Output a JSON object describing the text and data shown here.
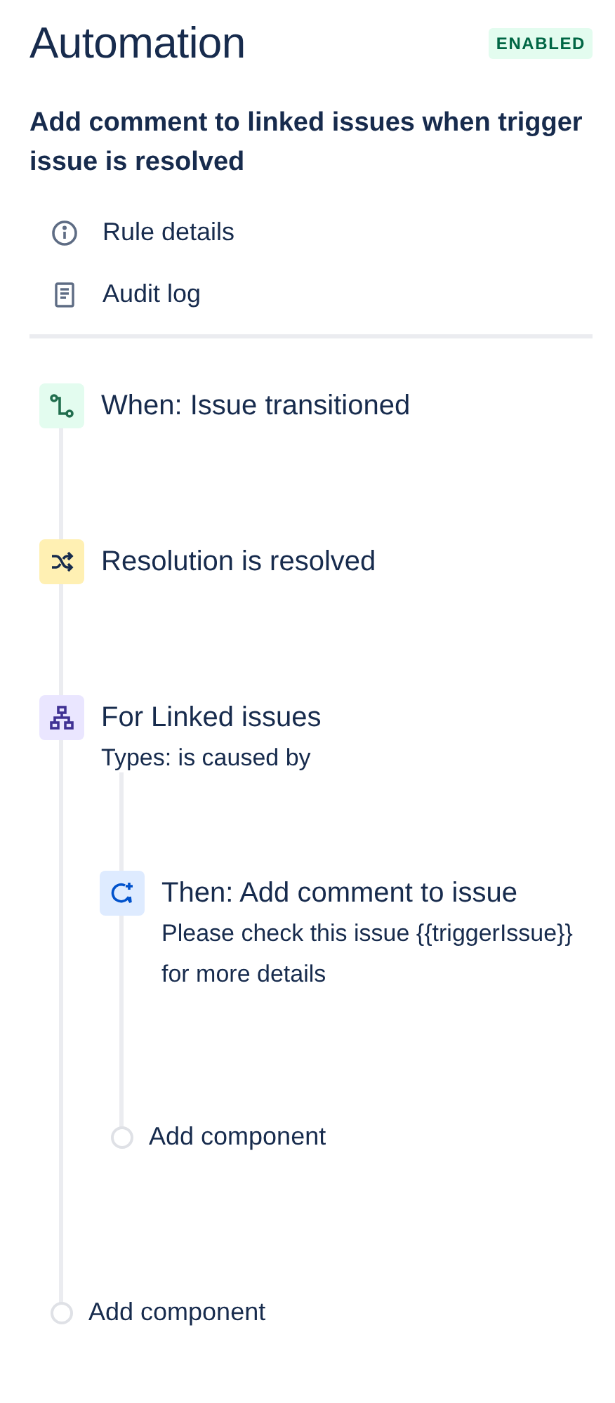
{
  "header": {
    "title": "Automation",
    "status": "ENABLED",
    "enabled": true
  },
  "rule_name": "Add comment to linked issues when trigger issue is resolved",
  "menu": [
    {
      "kind": "info",
      "label": "Rule details"
    },
    {
      "kind": "log",
      "label": "Audit log"
    }
  ],
  "steps": [
    {
      "kind": "trigger",
      "title": "When: Issue transitioned"
    },
    {
      "kind": "condition",
      "title": "Resolution is resolved"
    },
    {
      "kind": "branch",
      "title": "For Linked issues",
      "description": "Types: is caused by",
      "children": [
        {
          "kind": "action",
          "title": "Then: Add comment to issue",
          "description": "Please check this issue {{triggerIssue}} for more details"
        },
        {
          "kind": "add",
          "title": "Add component"
        }
      ]
    },
    {
      "kind": "add",
      "title": "Add component"
    }
  ]
}
